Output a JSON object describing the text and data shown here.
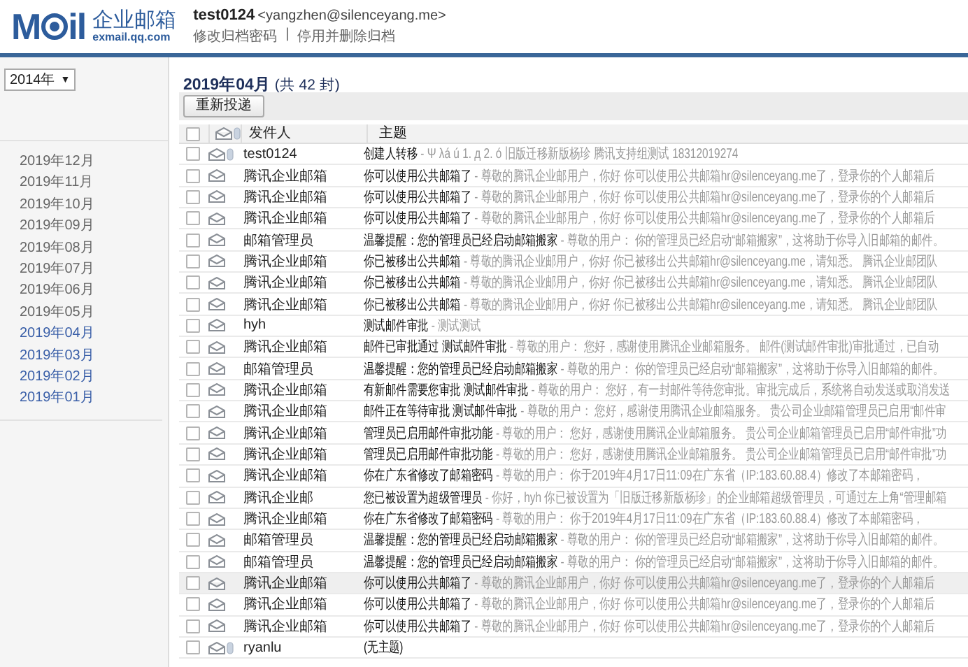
{
  "header": {
    "logo": {
      "start": "M",
      "end": "il",
      "product": "企业邮箱",
      "domain": "exmail.qq.com"
    },
    "account": "test0124",
    "email": "<yangzhen@silenceyang.me>",
    "links": [
      "修改归档密码",
      "停用并删除归档"
    ],
    "separator": "|"
  },
  "sidebar": {
    "year": "2014年",
    "year_caret": "▼",
    "months": [
      {
        "label": "2019年12月",
        "has_mail": false
      },
      {
        "label": "2019年11月",
        "has_mail": false
      },
      {
        "label": "2019年10月",
        "has_mail": false
      },
      {
        "label": "2019年09月",
        "has_mail": false
      },
      {
        "label": "2019年08月",
        "has_mail": false
      },
      {
        "label": "2019年07月",
        "has_mail": false
      },
      {
        "label": "2019年06月",
        "has_mail": false
      },
      {
        "label": "2019年05月",
        "has_mail": false
      },
      {
        "label": "2019年04月",
        "has_mail": true
      },
      {
        "label": "2019年03月",
        "has_mail": true
      },
      {
        "label": "2019年02月",
        "has_mail": true
      },
      {
        "label": "2019年01月",
        "has_mail": true
      }
    ]
  },
  "main": {
    "title": "2019年04月",
    "count": "(共 42 封)",
    "resend_button": "重新投递",
    "all_checked": false,
    "columns": [
      "发件人",
      "主题"
    ],
    "rows": [
      {
        "checked": false,
        "sender": "test0124",
        "subject": "创建人转移",
        "preview": " - Ψ λá ú 1. д 2. ó 旧版迁移新版杨珍 腾讯支持组测试 18312019274",
        "attachment": true,
        "highlighted": false
      },
      {
        "checked": false,
        "sender": "腾讯企业邮箱",
        "subject": "你可以使用公共邮箱了",
        "preview": " - 尊敬的腾讯企业邮用户，你好 你可以使用公共邮箱hr@silenceyang.me了，登录你的个人邮箱后",
        "attachment": false,
        "highlighted": false
      },
      {
        "checked": false,
        "sender": "腾讯企业邮箱",
        "subject": "你可以使用公共邮箱了",
        "preview": " - 尊敬的腾讯企业邮用户，你好 你可以使用公共邮箱hr@silenceyang.me了，登录你的个人邮箱后",
        "attachment": false,
        "highlighted": false
      },
      {
        "checked": false,
        "sender": "腾讯企业邮箱",
        "subject": "你可以使用公共邮箱了",
        "preview": " - 尊敬的腾讯企业邮用户，你好 你可以使用公共邮箱hr@silenceyang.me了，登录你的个人邮箱后",
        "attachment": false,
        "highlighted": false
      },
      {
        "checked": false,
        "sender": "邮箱管理员",
        "subject": "温馨提醒：您的管理员已经启动邮箱搬家",
        "preview": " - 尊敬的用户： 你的管理员已经启动“邮箱搬家”，这将助于你导入旧邮箱的邮件。",
        "attachment": false,
        "highlighted": false
      },
      {
        "checked": false,
        "sender": "腾讯企业邮箱",
        "subject": "你已被移出公共邮箱",
        "preview": " - 尊敬的腾讯企业邮用户，你好 你已被移出公共邮箱hr@silenceyang.me，请知悉。 腾讯企业邮团队",
        "attachment": false,
        "highlighted": false
      },
      {
        "checked": false,
        "sender": "腾讯企业邮箱",
        "subject": "你已被移出公共邮箱",
        "preview": " - 尊敬的腾讯企业邮用户，你好 你已被移出公共邮箱hr@silenceyang.me，请知悉。 腾讯企业邮团队",
        "attachment": false,
        "highlighted": false
      },
      {
        "checked": false,
        "sender": "腾讯企业邮箱",
        "subject": "你已被移出公共邮箱",
        "preview": " - 尊敬的腾讯企业邮用户，你好 你已被移出公共邮箱hr@silenceyang.me，请知悉。 腾讯企业邮团队",
        "attachment": false,
        "highlighted": false
      },
      {
        "checked": false,
        "sender": "hyh",
        "subject": "测试邮件审批",
        "preview": " - 测试测试",
        "attachment": false,
        "highlighted": false
      },
      {
        "checked": false,
        "sender": "腾讯企业邮箱",
        "subject": "邮件已审批通过 测试邮件审批",
        "preview": " - 尊敬的用户： 您好，感谢使用腾讯企业邮箱服务。 邮件(测试邮件审批)审批通过，已自动",
        "attachment": false,
        "highlighted": false
      },
      {
        "checked": false,
        "sender": "邮箱管理员",
        "subject": "温馨提醒：您的管理员已经启动邮箱搬家",
        "preview": " - 尊敬的用户： 你的管理员已经启动“邮箱搬家”，这将助于你导入旧邮箱的邮件。",
        "attachment": false,
        "highlighted": false
      },
      {
        "checked": false,
        "sender": "腾讯企业邮箱",
        "subject": "有新邮件需要您审批 测试邮件审批",
        "preview": " - 尊敬的用户： 您好，有一封邮件等待您审批。审批完成后，系统将自动发送或取消发送",
        "attachment": false,
        "highlighted": false
      },
      {
        "checked": false,
        "sender": "腾讯企业邮箱",
        "subject": "邮件正在等待审批 测试邮件审批",
        "preview": " - 尊敬的用户： 您好，感谢使用腾讯企业邮箱服务。 贵公司企业邮箱管理员已启用“邮件审",
        "attachment": false,
        "highlighted": false
      },
      {
        "checked": false,
        "sender": "腾讯企业邮箱",
        "subject": "管理员已启用邮件审批功能",
        "preview": " - 尊敬的用户： 您好，感谢使用腾讯企业邮箱服务。 贵公司企业邮箱管理员已启用“邮件审批”功",
        "attachment": false,
        "highlighted": false
      },
      {
        "checked": false,
        "sender": "腾讯企业邮箱",
        "subject": "管理员已启用邮件审批功能",
        "preview": " - 尊敬的用户： 您好，感谢使用腾讯企业邮箱服务。 贵公司企业邮箱管理员已启用“邮件审批”功",
        "attachment": false,
        "highlighted": false
      },
      {
        "checked": false,
        "sender": "腾讯企业邮箱",
        "subject": "你在广东省修改了邮箱密码",
        "preview": " - 尊敬的用户： 你于2019年4月17日11:09在广东省（IP:183.60.88.4）修改了本邮箱密码，",
        "attachment": false,
        "highlighted": false
      },
      {
        "checked": false,
        "sender": "腾讯企业邮",
        "subject": "您已被设置为超级管理员",
        "preview": " - 你好，hyh 你已被设置为「旧版迁移新版杨珍」的企业邮箱超级管理员，可通过左上角“管理邮箱",
        "attachment": false,
        "highlighted": false
      },
      {
        "checked": false,
        "sender": "腾讯企业邮箱",
        "subject": "你在广东省修改了邮箱密码",
        "preview": " - 尊敬的用户： 你于2019年4月17日11:09在广东省（IP:183.60.88.4）修改了本邮箱密码，",
        "attachment": false,
        "highlighted": false
      },
      {
        "checked": false,
        "sender": "邮箱管理员",
        "subject": "温馨提醒：您的管理员已经启动邮箱搬家",
        "preview": " - 尊敬的用户： 你的管理员已经启动“邮箱搬家”，这将助于你导入旧邮箱的邮件。",
        "attachment": false,
        "highlighted": false
      },
      {
        "checked": false,
        "sender": "邮箱管理员",
        "subject": "温馨提醒：您的管理员已经启动邮箱搬家",
        "preview": " - 尊敬的用户： 你的管理员已经启动“邮箱搬家”，这将助于你导入旧邮箱的邮件。",
        "attachment": false,
        "highlighted": false
      },
      {
        "checked": false,
        "sender": "腾讯企业邮箱",
        "subject": "你可以使用公共邮箱了",
        "preview": " - 尊敬的腾讯企业邮用户，你好 你可以使用公共邮箱hr@silenceyang.me了，登录你的个人邮箱后",
        "attachment": false,
        "highlighted": true
      },
      {
        "checked": false,
        "sender": "腾讯企业邮箱",
        "subject": "你可以使用公共邮箱了",
        "preview": " - 尊敬的腾讯企业邮用户，你好 你可以使用公共邮箱hr@silenceyang.me了，登录你的个人邮箱后",
        "attachment": false,
        "highlighted": false
      },
      {
        "checked": false,
        "sender": "腾讯企业邮箱",
        "subject": "你可以使用公共邮箱了",
        "preview": " - 尊敬的腾讯企业邮用户，你好 你可以使用公共邮箱hr@silenceyang.me了，登录你的个人邮箱后",
        "attachment": false,
        "highlighted": false
      },
      {
        "checked": false,
        "sender": "ryanlu",
        "subject": "(无主题)",
        "preview": "",
        "attachment": true,
        "highlighted": false
      }
    ]
  }
}
